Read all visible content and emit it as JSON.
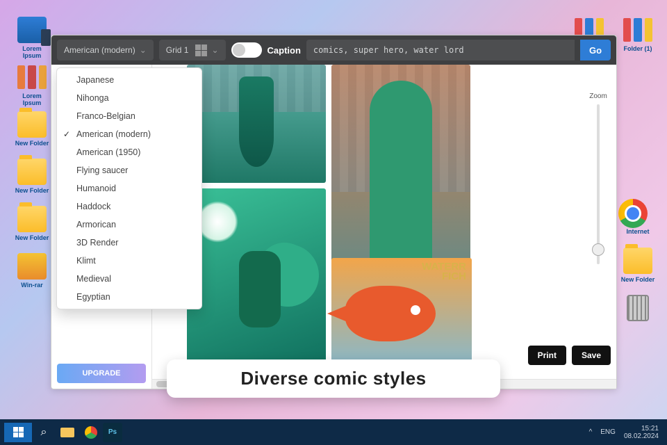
{
  "desktop": {
    "icons_left": [
      {
        "label": "Lorem Ipsum",
        "kind": "pc"
      },
      {
        "label": "Lorem Ipsum",
        "kind": "binders-b2"
      },
      {
        "label": "New Folder",
        "kind": "folder"
      },
      {
        "label": "New Folder",
        "kind": "folder"
      },
      {
        "label": "New Folder",
        "kind": "folder"
      },
      {
        "label": "Win-rar",
        "kind": "rar"
      }
    ],
    "icons_right": [
      {
        "label": "",
        "kind": "binders"
      },
      {
        "label": "Folder (1)",
        "kind": "binders"
      },
      {
        "label": "Internet",
        "kind": "chrome"
      },
      {
        "label": "New Folder",
        "kind": "folder"
      },
      {
        "label": "",
        "kind": "trash"
      }
    ]
  },
  "app": {
    "style_select": {
      "value": "American (modern)"
    },
    "grid_select": {
      "value": "Grid 1"
    },
    "caption_label": "Caption",
    "prompt_value": "comics, super hero, water lord",
    "go_label": "Go",
    "upgrade_label": "UPGRADE",
    "zoom_label": "Zoom",
    "print_label": "Print",
    "save_label": "Save",
    "style_options": [
      "Japanese",
      "Nihonga",
      "Franco-Belgian",
      "American (modern)",
      "American (1950)",
      "Flying saucer",
      "Humanoid",
      "Haddock",
      "Armorican",
      "3D Render",
      "Klimt",
      "Medieval",
      "Egyptian"
    ],
    "style_selected": "American (modern)",
    "panel4_title_a": "WATERR",
    "panel4_title_b": "FICH"
  },
  "caption_card": "Diverse comic styles",
  "taskbar": {
    "tray_up": "^",
    "lang": "ENG",
    "time": "15:21",
    "date": "08.02.2024"
  }
}
